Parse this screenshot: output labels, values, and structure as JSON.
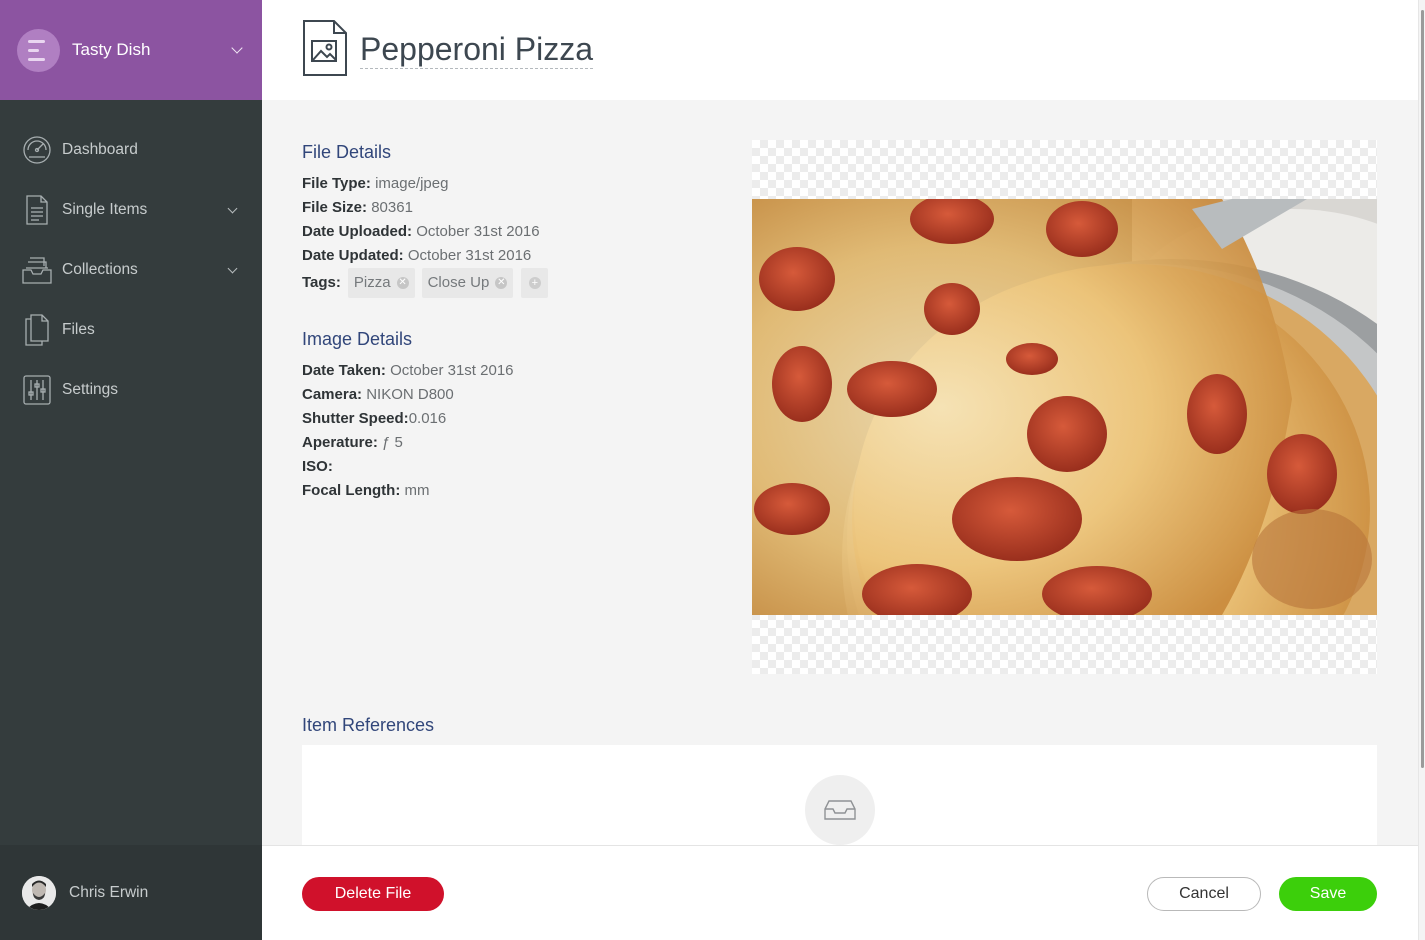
{
  "brand": {
    "name": "Tasty Dish",
    "color": "#8c54a1"
  },
  "sidebar": {
    "items": [
      {
        "label": "Dashboard",
        "icon": "dashboard-gauge-icon",
        "has_dropdown": false
      },
      {
        "label": "Single Items",
        "icon": "document-icon",
        "has_dropdown": true
      },
      {
        "label": "Collections",
        "icon": "inbox-stack-icon",
        "has_dropdown": true
      },
      {
        "label": "Files",
        "icon": "files-icon",
        "has_dropdown": false
      },
      {
        "label": "Settings",
        "icon": "sliders-icon",
        "has_dropdown": false
      }
    ]
  },
  "user": {
    "name": "Chris Erwin"
  },
  "header": {
    "title": "Pepperoni Pizza",
    "icon": "image-file-icon"
  },
  "file_details": {
    "title": "File Details",
    "file_type_label": "File Type:",
    "file_type": "image/jpeg",
    "file_size_label": "File Size:",
    "file_size": "80361",
    "date_uploaded_label": "Date Uploaded:",
    "date_uploaded": "October 31st 2016",
    "date_updated_label": "Date Updated:",
    "date_updated": "October 31st 2016",
    "tags_label": "Tags:",
    "tags": [
      "Pizza",
      "Close Up"
    ]
  },
  "image_details": {
    "title": "Image Details",
    "date_taken_label": "Date Taken:",
    "date_taken": "October 31st 2016",
    "camera_label": "Camera:",
    "camera": "NIKON D800",
    "shutter_speed_label": "Shutter Speed:",
    "shutter_speed": "0.016",
    "aperture_label": "Aperature:",
    "aperture": "ƒ 5",
    "iso_label": "ISO:",
    "iso": "",
    "focal_length_label": "Focal Length:",
    "focal_length": "mm"
  },
  "references": {
    "title": "Item References",
    "empty_icon": "empty-inbox-icon"
  },
  "footer": {
    "delete_label": "Delete File",
    "cancel_label": "Cancel",
    "save_label": "Save"
  },
  "colors": {
    "sidebar": "#343c3d",
    "delete": "#d0112b",
    "save": "#3ccf0b",
    "heading": "#31467a"
  }
}
